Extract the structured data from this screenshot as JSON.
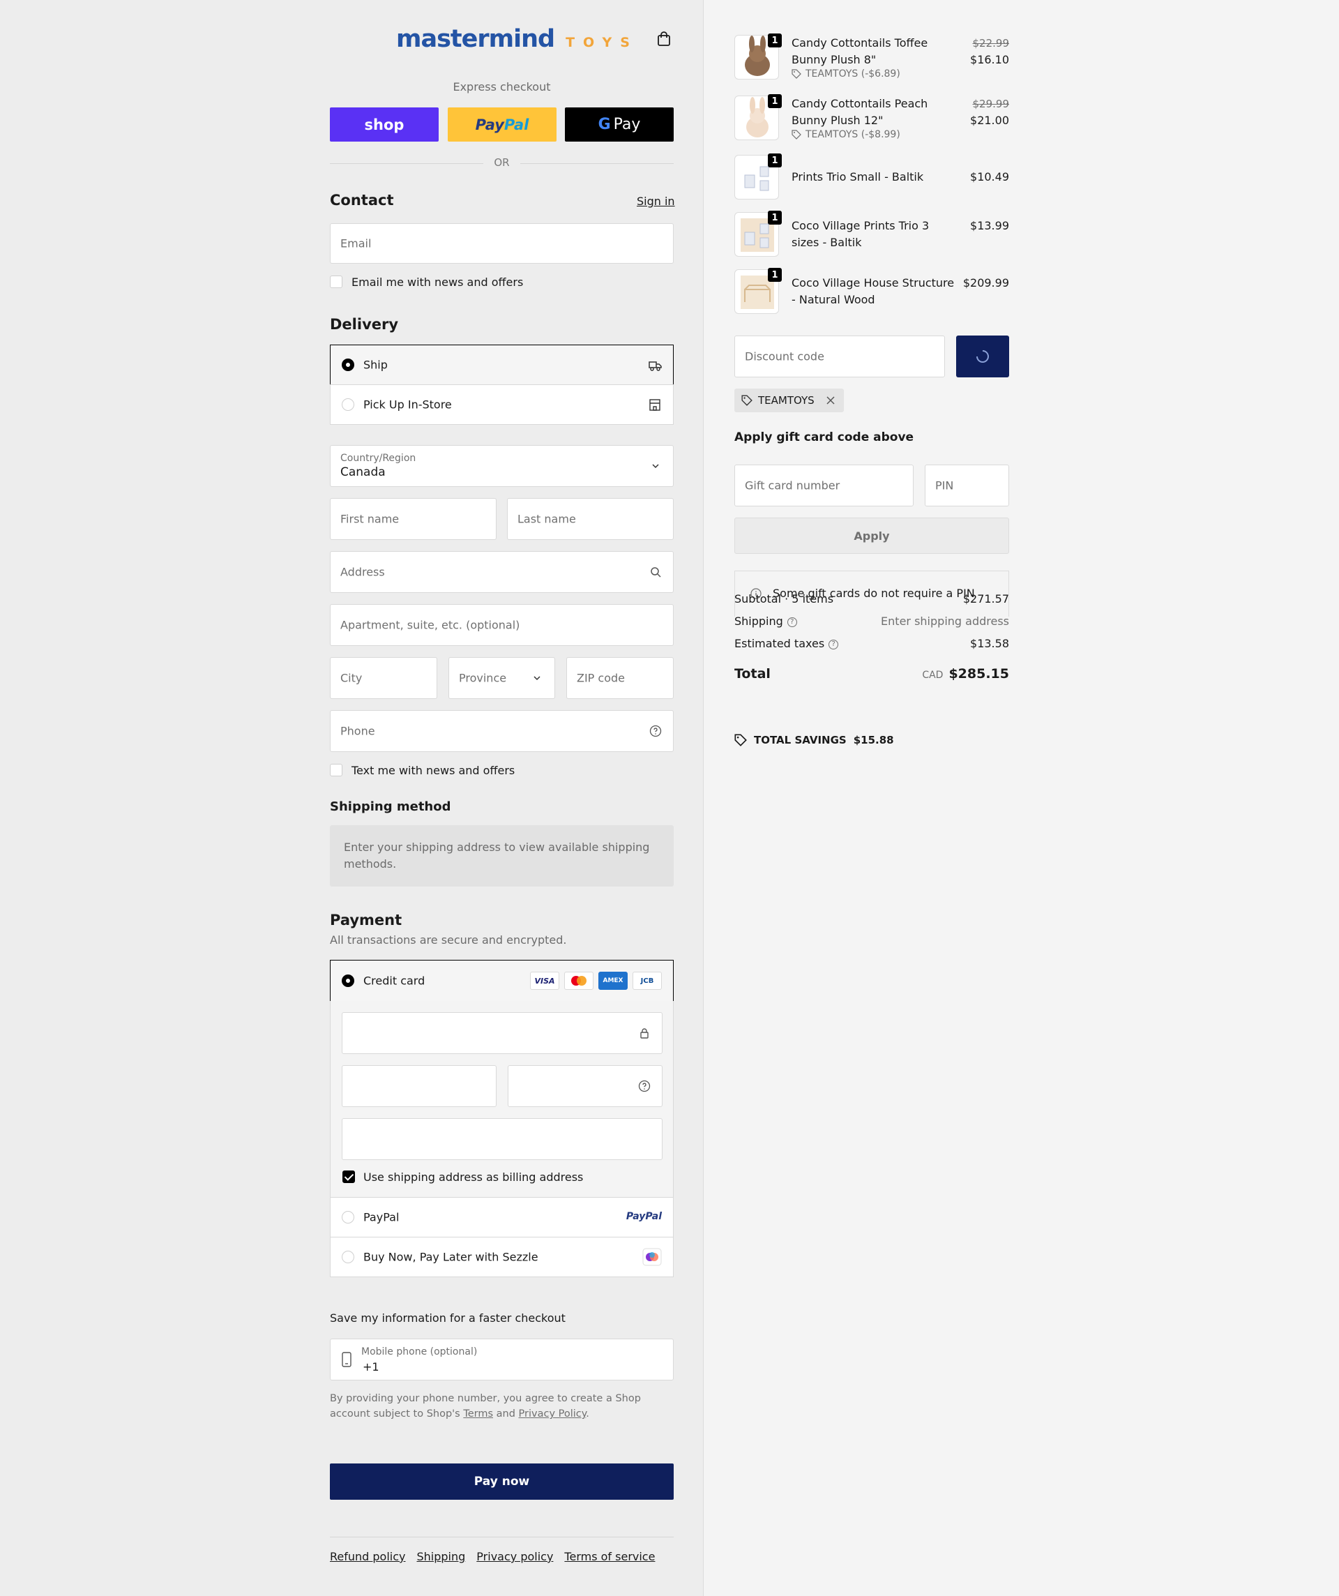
{
  "header": {
    "brand_main": "mastermind",
    "brand_sub": "TOYS"
  },
  "express": {
    "label": "Express checkout",
    "shop_label": "shop",
    "paypal_a": "Pay",
    "paypal_b": "Pal",
    "gpay_g": "G",
    "gpay_label": "Pay",
    "or": "OR"
  },
  "contact": {
    "title": "Contact",
    "sign_in": "Sign in",
    "email_placeholder": "Email",
    "news_label": "Email me with news and offers"
  },
  "delivery": {
    "title": "Delivery",
    "options": [
      {
        "label": "Ship",
        "selected": true
      },
      {
        "label": "Pick Up In-Store",
        "selected": false
      }
    ],
    "country_label": "Country/Region",
    "country_value": "Canada",
    "first_name": "First name",
    "last_name": "Last name",
    "address": "Address",
    "apartment": "Apartment, suite, etc. (optional)",
    "city": "City",
    "province": "Province",
    "zip": "ZIP code",
    "phone": "Phone",
    "text_news": "Text me with news and offers"
  },
  "shipping_method": {
    "title": "Shipping method",
    "message": "Enter your shipping address to view available shipping methods."
  },
  "payment": {
    "title": "Payment",
    "subtitle": "All transactions are secure and encrypted.",
    "credit_card": "Credit card",
    "card_brands": [
      "VISA",
      "MC",
      "AMEX",
      "JCB"
    ],
    "billing_label": "Use shipping address as billing address",
    "paypal": "PayPal",
    "paypal_logo": "PayPal",
    "sezzle": "Buy Now, Pay Later with Sezzle"
  },
  "save_info": {
    "title": "Save my information for a faster checkout",
    "phone_label": "Mobile phone (optional)",
    "phone_prefix": "+1",
    "legal_a": "By providing your phone number, you agree to create a Shop",
    "legal_b": "account subject to Shop's ",
    "terms": "Terms",
    "and": " and ",
    "privacy": "Privacy Policy",
    "period": "."
  },
  "pay_now": "Pay now",
  "footer": [
    "Refund policy",
    "Shipping",
    "Privacy policy",
    "Terms of service"
  ],
  "cart": {
    "items": [
      {
        "qty": "1",
        "name": "Candy Cottontails Toffee Bunny Plush 8\"",
        "original": "$22.99",
        "price": "$16.10",
        "discount": "TEAMTOYS (-$6.89)"
      },
      {
        "qty": "1",
        "name": "Candy Cottontails Peach Bunny Plush 12\"",
        "original": "$29.99",
        "price": "$21.00",
        "discount": "TEAMTOYS (-$8.99)"
      },
      {
        "qty": "1",
        "name": "Prints Trio Small - Baltik",
        "price": "$10.49"
      },
      {
        "qty": "1",
        "name": "Coco Village Prints Trio 3 sizes - Baltik",
        "price": "$13.99"
      },
      {
        "qty": "1",
        "name": "Coco Village House Structure - Natural Wood",
        "price": "$209.99"
      }
    ],
    "discount_placeholder": "Discount code",
    "applied_code": "TEAMTOYS",
    "gift_title": "Apply gift card code above",
    "gift_number": "Gift card number",
    "gift_pin": "PIN",
    "apply": "Apply",
    "gift_notice": "Some gift cards do not require a PIN",
    "subtotal_label": "Subtotal · 5 items",
    "subtotal": "$271.57",
    "shipping_label": "Shipping",
    "shipping_value": "Enter shipping address",
    "taxes_label": "Estimated taxes",
    "taxes": "$13.58",
    "total_label": "Total",
    "currency": "CAD",
    "total": "$285.15",
    "savings_label": "TOTAL SAVINGS",
    "savings": "$15.88"
  },
  "colors": {
    "accent": "#0f1f5c",
    "shop": "#5a31f4",
    "paypal": "#ffc439",
    "brand_blue": "#2454a5",
    "brand_orange": "#f2a53a"
  }
}
